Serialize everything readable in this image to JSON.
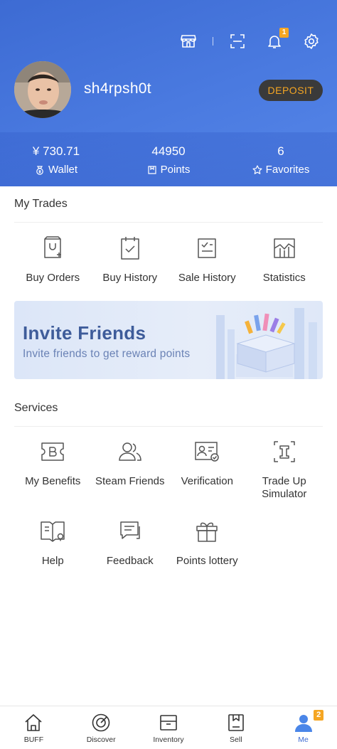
{
  "header": {
    "notification_count": "1",
    "username": "sh4rpsh0t",
    "deposit_label": "DEPOSIT"
  },
  "stats": [
    {
      "value": "¥ 730.71",
      "label": "Wallet",
      "icon": "wallet-icon"
    },
    {
      "value": "44950",
      "label": "Points",
      "icon": "points-icon"
    },
    {
      "value": "6",
      "label": "Favorites",
      "icon": "star-icon"
    }
  ],
  "my_trades": {
    "title": "My Trades",
    "items": [
      {
        "label": "Buy Orders",
        "icon": "buy-orders-icon"
      },
      {
        "label": "Buy History",
        "icon": "buy-history-icon"
      },
      {
        "label": "Sale History",
        "icon": "sale-history-icon"
      },
      {
        "label": "Statistics",
        "icon": "statistics-icon"
      }
    ]
  },
  "banner": {
    "title": "Invite Friends",
    "subtitle": "Invite friends to get reward points"
  },
  "services": {
    "title": "Services",
    "items": [
      {
        "label": "My Benefits",
        "icon": "benefits-icon"
      },
      {
        "label": "Steam Friends",
        "icon": "friends-icon"
      },
      {
        "label": "Verification",
        "icon": "verification-icon"
      },
      {
        "label": "Trade Up\nSimulator",
        "icon": "trade-up-icon"
      },
      {
        "label": "Help",
        "icon": "help-icon"
      },
      {
        "label": "Feedback",
        "icon": "feedback-icon"
      },
      {
        "label": "Points lottery",
        "icon": "gift-icon"
      }
    ]
  },
  "bottom_nav": {
    "items": [
      {
        "label": "BUFF",
        "icon": "home-icon"
      },
      {
        "label": "Discover",
        "icon": "discover-icon"
      },
      {
        "label": "Inventory",
        "icon": "inventory-icon"
      },
      {
        "label": "Sell",
        "icon": "sell-icon"
      },
      {
        "label": "Me",
        "icon": "me-icon"
      }
    ],
    "me_badge": "2",
    "active": "Me"
  },
  "colors": {
    "header_blue": "#4a7ae0",
    "accent_orange": "#f5a623",
    "active_blue": "#3d6bd3"
  }
}
